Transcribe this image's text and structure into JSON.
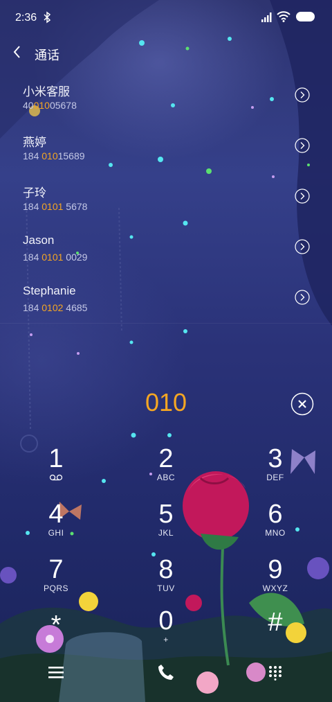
{
  "status_bar": {
    "time": "2:36"
  },
  "header": {
    "title": "通话"
  },
  "contacts": [
    {
      "name": "小米客服",
      "pre": "40",
      "hl": "010",
      "post": "05678"
    },
    {
      "name": "燕婷",
      "pre": "184 ",
      "hl": "010",
      "post": "15689"
    },
    {
      "name": "子玲",
      "pre": "184 ",
      "hl": "0101",
      "post": " 5678"
    },
    {
      "name": "Jason",
      "pre": "184 ",
      "hl": "0101",
      "post": " 0029"
    },
    {
      "name": "Stephanie",
      "pre": "184 ",
      "hl": "0102",
      "post": " 4685"
    }
  ],
  "dialer": {
    "query": "010",
    "keys": [
      {
        "digit": "1",
        "letters": ""
      },
      {
        "digit": "2",
        "letters": "ABC"
      },
      {
        "digit": "3",
        "letters": "DEF"
      },
      {
        "digit": "4",
        "letters": "GHI"
      },
      {
        "digit": "5",
        "letters": "JKL"
      },
      {
        "digit": "6",
        "letters": "MNO"
      },
      {
        "digit": "7",
        "letters": "PQRS"
      },
      {
        "digit": "8",
        "letters": "TUV"
      },
      {
        "digit": "9",
        "letters": "WXYZ"
      },
      {
        "digit": "*",
        "letters": ""
      },
      {
        "digit": "0",
        "letters": "+"
      },
      {
        "digit": "#",
        "letters": ""
      }
    ]
  },
  "icons": {
    "back": "back-arrow-icon",
    "row_action": "chevron-right-circle-icon",
    "clear": "clear-circle-icon",
    "menu": "menu-icon",
    "call": "phone-icon",
    "keypad": "keypad-grid-icon"
  },
  "colors": {
    "accent": "#f5a623",
    "background": "#2a3278"
  }
}
